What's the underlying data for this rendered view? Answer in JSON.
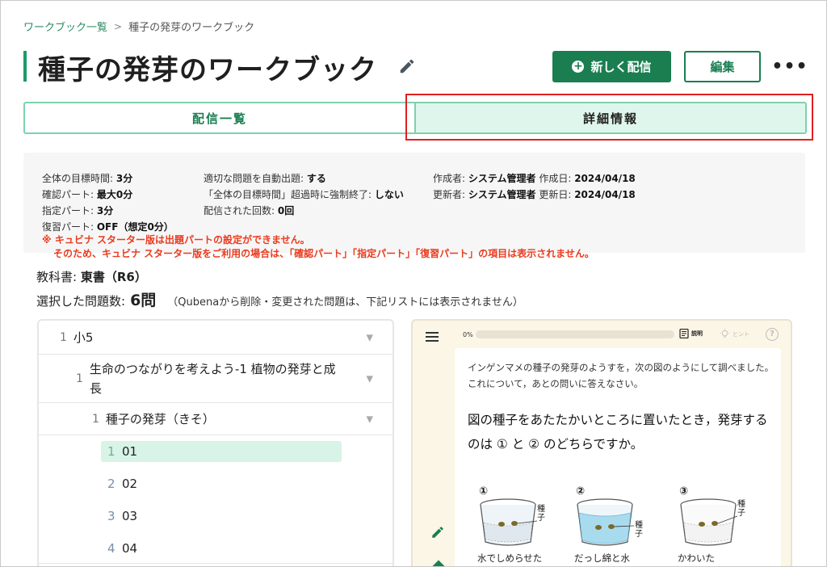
{
  "breadcrumb": {
    "parent": "ワークブック一覧",
    "separator": ">",
    "current": "種子の発芽のワークブック"
  },
  "header": {
    "title": "種子の発芽のワークブック",
    "new_delivery_label": "新しく配信",
    "edit_label": "編集",
    "more_label": "•••"
  },
  "tabs": [
    {
      "label": "配信一覧"
    },
    {
      "label": "詳細情報"
    }
  ],
  "info": {
    "col1": [
      {
        "label": "全体の目標時間: ",
        "value": "3分"
      },
      {
        "label": "確認パート: ",
        "value": "最大0分"
      },
      {
        "label": "指定パート: ",
        "value": "3分"
      },
      {
        "label": "復習パート: ",
        "value": "OFF（想定0分）"
      }
    ],
    "col2": [
      {
        "label": "適切な問題を自動出題: ",
        "value": "する"
      },
      {
        "label": "「全体の目標時間」超過時に強制終了: ",
        "value": "しない"
      },
      {
        "label": "配信された回数: ",
        "value": "0回"
      }
    ],
    "col3": [
      {
        "label": "作成者: ",
        "value": "システム管理者",
        "label2": "  作成日: ",
        "value2": "2024/04/18"
      },
      {
        "label": "更新者: ",
        "value": "システム管理者",
        "label2": "  更新日: ",
        "value2": "2024/04/18"
      }
    ],
    "notice_line1": "※ キュビナ スターター版は出題パートの設定ができません。",
    "notice_line2": "そのため、キュビナ スターター版をご利用の場合は、「確認パート」「指定パート」「復習パート」の項目は表示されません。"
  },
  "textbook": {
    "label": "教科書: ",
    "value": "東書（R6）"
  },
  "selected": {
    "label": "選択した問題数: ",
    "count": "6問",
    "note": "（Qubenaから削除・変更された問題は、下記リストには表示されません）"
  },
  "tree": {
    "level1": {
      "num": "1",
      "label": "小5"
    },
    "level2": {
      "num": "1",
      "label_line1": "生命のつながりを考えよう-1 植物の発芽と成",
      "label_line2": "長"
    },
    "level3": {
      "num": "1",
      "label": "種子の発芽（きそ）"
    },
    "leaves": [
      {
        "num": "1",
        "label": "01"
      },
      {
        "num": "2",
        "label": "02"
      },
      {
        "num": "3",
        "label": "03"
      },
      {
        "num": "4",
        "label": "04"
      }
    ],
    "caret": "▼"
  },
  "preview": {
    "progress_label": "0%",
    "progress_value": 0,
    "explain_label": "説明",
    "hint_label": "ヒント",
    "help_label": "?",
    "intro": "インゲンマメの種子の発芽のようすを，次の図のようにして調べました。これについて，あとの問いに答えなさい。",
    "question": "図の種子をあたたかいところに置いたとき，発芽するのは ① と ② のどちらですか。",
    "figures": [
      {
        "num": "①",
        "caption": "水でしめらせた",
        "seed_label": "種子"
      },
      {
        "num": "②",
        "caption": "だっし綿と水",
        "seed_label": "種子"
      },
      {
        "num": "③",
        "caption": "かわいた",
        "seed_label": "種子"
      }
    ]
  },
  "colors": {
    "accent": "#1a7e51",
    "tab_border": "#7fd1ad",
    "tab_active_bg": "#dff6ec",
    "notice": "#ea3b1e",
    "highlight": "#e02020"
  }
}
